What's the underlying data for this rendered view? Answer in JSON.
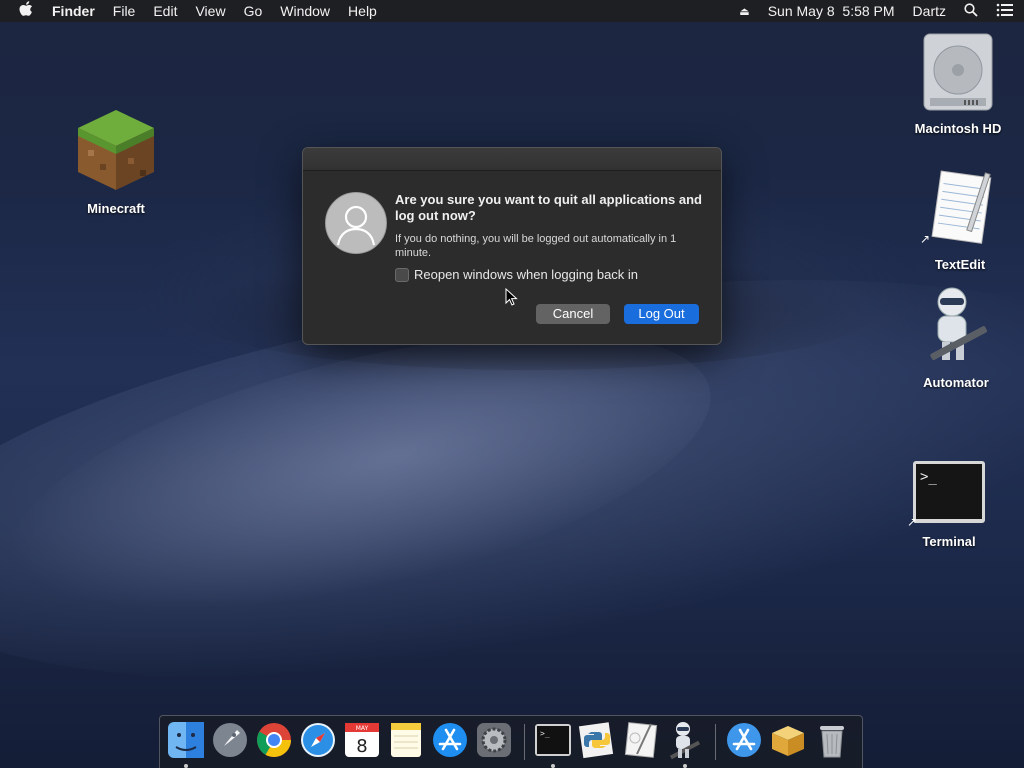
{
  "menubar": {
    "apple_icon": "apple-icon",
    "app_name": "Finder",
    "menus": [
      "File",
      "Edit",
      "View",
      "Go",
      "Window",
      "Help"
    ],
    "clock": "Sun May 8  5:58 PM",
    "user": "Dartz"
  },
  "desktop": {
    "minecraft": "Minecraft",
    "macintosh_hd": "Macintosh HD",
    "textedit": "TextEdit",
    "automator": "Automator",
    "terminal": "Terminal"
  },
  "dialog": {
    "title": "Are you sure you want to quit all applications and log out now?",
    "body": "If you do nothing, you will be logged out automatically in 1 minute.",
    "checkbox_label": "Reopen windows when logging back in",
    "checkbox_checked": false,
    "cancel_label": "Cancel",
    "logout_label": "Log Out"
  },
  "dock": {
    "calendar_month": "MAY",
    "calendar_day": "8",
    "items": [
      "Finder",
      "Launchpad",
      "Google Chrome",
      "Safari",
      "Calendar",
      "Notes",
      "App Store",
      "System Preferences",
      "Terminal",
      "Python Launcher",
      "Script Editor",
      "Automator",
      "Applications",
      "Downloads",
      "Trash"
    ]
  },
  "colors": {
    "accent": "#1a6ddc",
    "dialog_bg": "#2c2c2c"
  }
}
